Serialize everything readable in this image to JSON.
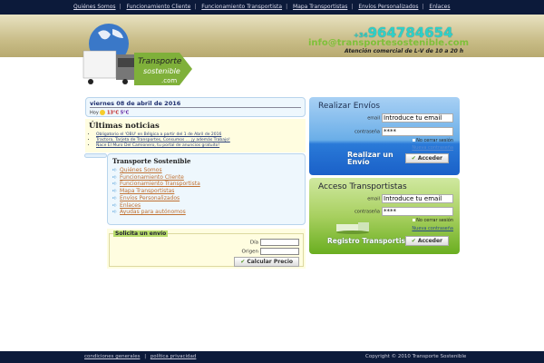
{
  "nav": [
    "Quiénes Somos",
    "Funcionamiento Cliente",
    "Funcionamiento Transportista",
    "Mapa Transportistas",
    "Envíos Personalizados",
    "Enlaces"
  ],
  "header": {
    "logo_text": "Transporte sostenible .com",
    "phone_prefix": "+34",
    "phone": "964784654",
    "email": "info@transportesostenible.com",
    "hours": "Atención comercial de L-V de 10 a 20 h"
  },
  "weather": {
    "date": "viernes 08 de abril de 2016",
    "day": "Hoy",
    "high": "13°C",
    "low": "5°C"
  },
  "news": {
    "title": "Últimas noticias",
    "items": [
      "Obligatorio el 'OBU' en Bélgica a partir del 1 de Abril de 2016",
      "Tractora, Tarjeta de Transportes, Consumos ... ¡y además Trabajo!",
      "Nace El Muro Del Camionero, tu portal de anuncios gratuito!"
    ]
  },
  "menu": {
    "title": "Transporte Sostenible",
    "items": [
      "Quiénes Somos",
      "Funcionamiento Cliente",
      "Funcionamiento Transportista",
      "Mapa Transportistas",
      "Envíos Personalizados",
      "Enlaces",
      "Ayudas para autónomos"
    ]
  },
  "quote": {
    "legend": "Solicita un envío",
    "dia_label": "Día",
    "origen_label": "Origen",
    "button": "Calcular Precio"
  },
  "envios": {
    "title": "Realizar Envíos",
    "email_label": "email",
    "email_value": "Introduce tu email",
    "pass_label": "contraseña",
    "pass_value": "****",
    "remember": "No cerrar sesión",
    "new_pass": "Nueva contraseña",
    "cta": "Realizar un Envío",
    "button": "Acceder"
  },
  "transportistas": {
    "title": "Acceso Transportistas",
    "email_label": "email",
    "email_value": "Introduce tu email",
    "pass_label": "contraseña",
    "pass_value": "****",
    "remember": "No cerrar sesión",
    "new_pass": "Nueva contraseña",
    "cta": "Registro Transportistas",
    "button": "Acceder"
  },
  "footer": {
    "links": [
      "condiciones generales",
      "política privacidad"
    ],
    "copyright": "Copyright © 2010 Transporte Sostenible"
  }
}
